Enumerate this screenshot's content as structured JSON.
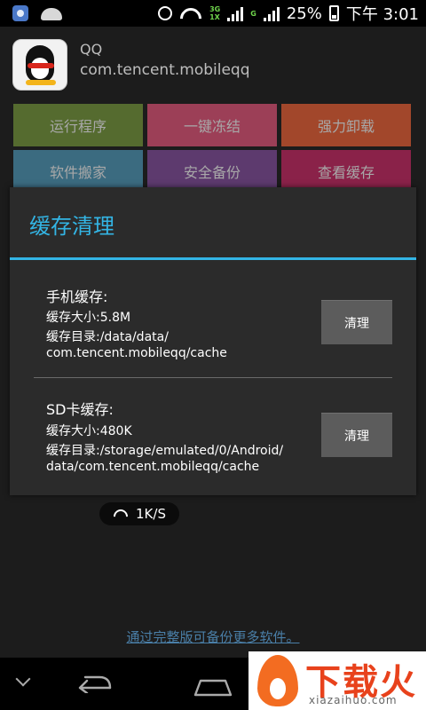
{
  "status_bar": {
    "network_top": "3G",
    "network_bottom": "1X",
    "network_g": "G",
    "battery": "25%",
    "time": "下午 3:01"
  },
  "app": {
    "name": "QQ",
    "package": "com.tencent.mobileqq"
  },
  "actions": [
    {
      "label": "运行程序",
      "color": "#556b2f"
    },
    {
      "label": "一键冻结",
      "color": "#9c3f57"
    },
    {
      "label": "强力卸载",
      "color": "#a2472b"
    },
    {
      "label": "软件搬家",
      "color": "#3b6b80"
    },
    {
      "label": "安全备份",
      "color": "#5d3a6e"
    },
    {
      "label": "查看缓存",
      "color": "#8a2249"
    }
  ],
  "dialog": {
    "title": "缓存清理",
    "phone": {
      "heading": "手机缓存:",
      "size": "缓存大小:5.8M",
      "dir_line1": "缓存目录:/data/data/",
      "dir_line2": "com.tencent.mobileqq/cache",
      "button": "清理"
    },
    "sd": {
      "heading": "SD卡缓存:",
      "size": "缓存大小:480K",
      "dir_line1": "缓存目录:/storage/emulated/0/Android/",
      "dir_line2": "data/com.tencent.mobileqq/cache",
      "button": "清理"
    }
  },
  "speed": "1K/S",
  "footer_link": "通过完整版可备份更多软件。",
  "watermark": {
    "text": "下载火",
    "url": "xiazaihuo.com"
  },
  "accent_color": "#33b5e5"
}
